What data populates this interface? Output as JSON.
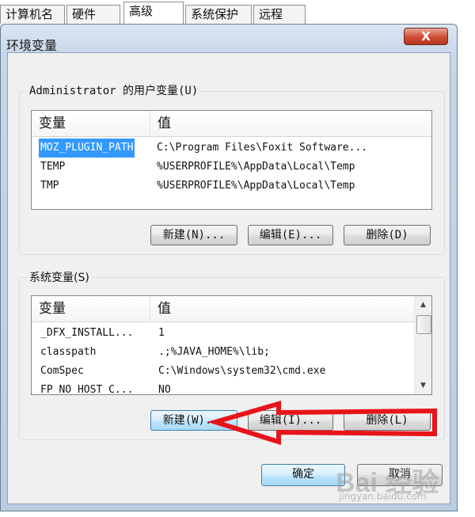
{
  "tabs": [
    "计算机名",
    "硬件",
    "高级",
    "系统保护",
    "远程"
  ],
  "window": {
    "title": "环境变量",
    "close_label": "X"
  },
  "user_vars": {
    "label": "Administrator 的用户变量(U)",
    "col_var": "变量",
    "col_val": "值",
    "rows": [
      {
        "name": "MOZ_PLUGIN_PATH",
        "value": "C:\\Program Files\\Foxit Software..."
      },
      {
        "name": "TEMP",
        "value": "%USERPROFILE%\\AppData\\Local\\Temp"
      },
      {
        "name": "TMP",
        "value": "%USERPROFILE%\\AppData\\Local\\Temp"
      }
    ],
    "new_btn": "新建(N)...",
    "edit_btn": "编辑(E)...",
    "delete_btn": "删除(D)"
  },
  "sys_vars": {
    "label": "系统变量(S)",
    "col_var": "变量",
    "col_val": "值",
    "rows": [
      {
        "name": "_DFX_INSTALL...",
        "value": "1"
      },
      {
        "name": "classpath",
        "value": ".;%JAVA_HOME%\\lib;"
      },
      {
        "name": "ComSpec",
        "value": "C:\\Windows\\system32\\cmd.exe"
      },
      {
        "name": "FP_NO_HOST_C...",
        "value": "NO"
      }
    ],
    "new_btn": "新建(W)...",
    "edit_btn": "编辑(I)...",
    "delete_btn": "删除(L)"
  },
  "footer": {
    "ok_btn": "确定",
    "cancel_btn": "取消"
  },
  "watermark": {
    "main": "Bai 经验",
    "sub": "jingyan.baidu.com"
  },
  "colors": {
    "selection": "#3399ff",
    "arrow": "#e8141b",
    "close": "#cf4c33"
  }
}
